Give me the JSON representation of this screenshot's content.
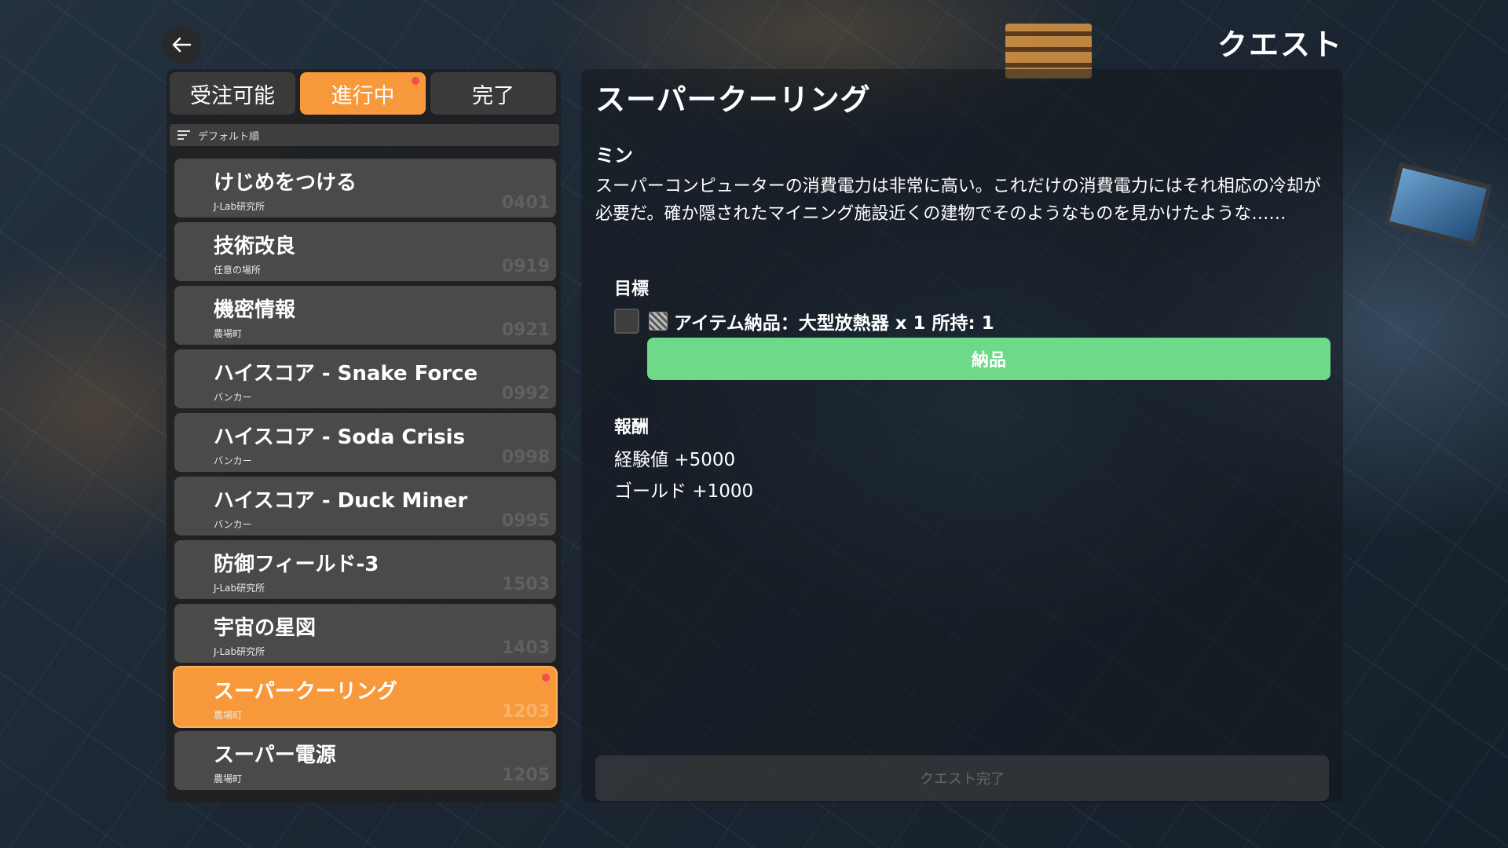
{
  "header": {
    "title": "クエスト"
  },
  "tabs": [
    {
      "label": "受注可能"
    },
    {
      "label": "進行中"
    },
    {
      "label": "完了"
    }
  ],
  "sort": {
    "label": "デフォルト順"
  },
  "quests": [
    {
      "title": "けじめをつける",
      "location": "J-Lab研究所",
      "id": "0401"
    },
    {
      "title": "技術改良",
      "location": "任意の場所",
      "id": "0919"
    },
    {
      "title": "機密情報",
      "location": "農場町",
      "id": "0921"
    },
    {
      "title": "ハイスコア - Snake Force",
      "location": "バンカー",
      "id": "0992"
    },
    {
      "title": "ハイスコア - Soda Crisis",
      "location": "バンカー",
      "id": "0998"
    },
    {
      "title": "ハイスコア - Duck Miner",
      "location": "バンカー",
      "id": "0995"
    },
    {
      "title": "防御フィールド-3",
      "location": "J-Lab研究所",
      "id": "1503"
    },
    {
      "title": "宇宙の星図",
      "location": "J-Lab研究所",
      "id": "1403"
    },
    {
      "title": "スーパークーリング",
      "location": "農場町",
      "id": "1203"
    },
    {
      "title": "スーパー電源",
      "location": "農場町",
      "id": "1205"
    }
  ],
  "detail": {
    "title": "スーパークーリング",
    "giver": "ミン",
    "description": "スーパーコンピューターの消費電力は非常に高い。これだけの消費電力にはそれ相応の冷却が必要だ。確か隠されたマイニング施設近くの建物でそのようなものを見かけたような……",
    "goal_heading": "目標",
    "objective": "アイテム納品：大型放熱器 x 1 所持: 1",
    "deliver_label": "納品",
    "reward_heading": "報酬",
    "rewards": [
      "経験値 +5000",
      "ゴールド +1000"
    ],
    "complete_label": "クエスト完了"
  },
  "colors": {
    "accent": "#f7993a",
    "deliver": "#6fd98a",
    "notification": "#ef4f4f"
  }
}
